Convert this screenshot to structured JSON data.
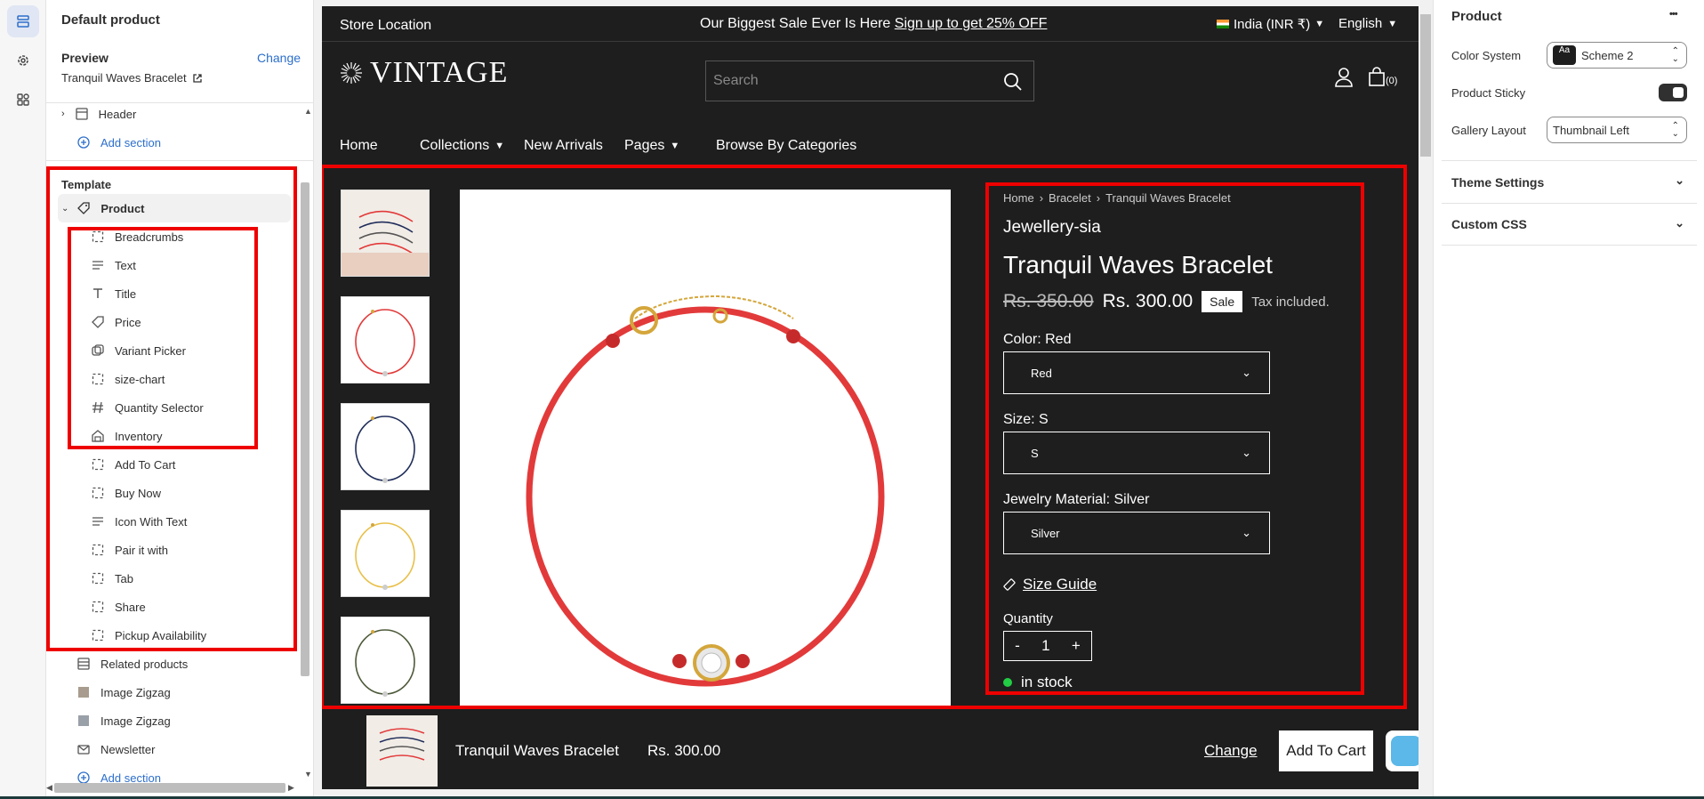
{
  "sidebar": {
    "title": "Default product",
    "preview_label": "Preview",
    "change_label": "Change",
    "preview_product": "Tranquil Waves Bracelet",
    "header_item": "Header",
    "add_section": "Add section",
    "template_label": "Template",
    "product_item": "Product",
    "blocks": [
      "Breadcrumbs",
      "Text",
      "Title",
      "Price",
      "Variant Picker",
      "size-chart",
      "Quantity Selector",
      "Inventory",
      "Add To Cart",
      "Buy Now",
      "Icon With Text",
      "Pair it with",
      "Tab",
      "Share",
      "Pickup Availability"
    ],
    "sections": [
      "Related products",
      "Image Zigzag",
      "Image Zigzag",
      "Newsletter"
    ],
    "add_section_bottom": "Add section"
  },
  "store": {
    "store_location": "Store Location",
    "announcement": "Our Biggest Sale Ever Is Here",
    "announcement_link": "Sign up to get 25% OFF",
    "country": "India (INR ₹)",
    "language": "English",
    "logo": "VINTAGE",
    "search_placeholder": "Search",
    "cart_count": "(0)",
    "nav": [
      "Home",
      "Collections",
      "New Arrivals",
      "Pages",
      "Browse By Categories"
    ],
    "breadcrumb": [
      "Home",
      "Bracelet",
      "Tranquil Waves Bracelet"
    ],
    "vendor": "Jewellery-sia",
    "product_title": "Tranquil Waves Bracelet",
    "compare_price": "Rs. 350.00",
    "price": "Rs. 300.00",
    "sale_badge": "Sale",
    "tax_note": "Tax included.",
    "color_label": "Color: Red",
    "color_value": "Red",
    "size_label": "Size: S",
    "size_value": "S",
    "material_label": "Jewelry Material: Silver",
    "material_value": "Silver",
    "size_guide": "Size Guide",
    "quantity_label": "Quantity",
    "qty_minus": "-",
    "qty_value": "1",
    "qty_plus": "+",
    "stock": "in stock",
    "sticky_title": "Tranquil Waves Bracelet",
    "sticky_price": "Rs. 300.00",
    "sticky_change": "Change",
    "sticky_add": "Add To Cart",
    "thumb_colors": [
      "#e23a3a",
      "#e23a3a",
      "#1f2d5a",
      "#e8c04a",
      "#4d5a3a"
    ]
  },
  "right": {
    "title": "Product",
    "more": "•••",
    "color_system_label": "Color System",
    "color_system_icon": "Aa",
    "color_system_value": "Scheme 2",
    "sticky_label": "Product Sticky",
    "sticky_on": true,
    "gallery_label": "Gallery Layout",
    "gallery_value": "Thumbnail Left",
    "theme_settings": "Theme Settings",
    "custom_css": "Custom CSS"
  },
  "colors": {
    "highlight": "#e00000",
    "accent": "#2c6ecb",
    "stock": "#22cc44",
    "bracelet": "#e23a3a"
  }
}
